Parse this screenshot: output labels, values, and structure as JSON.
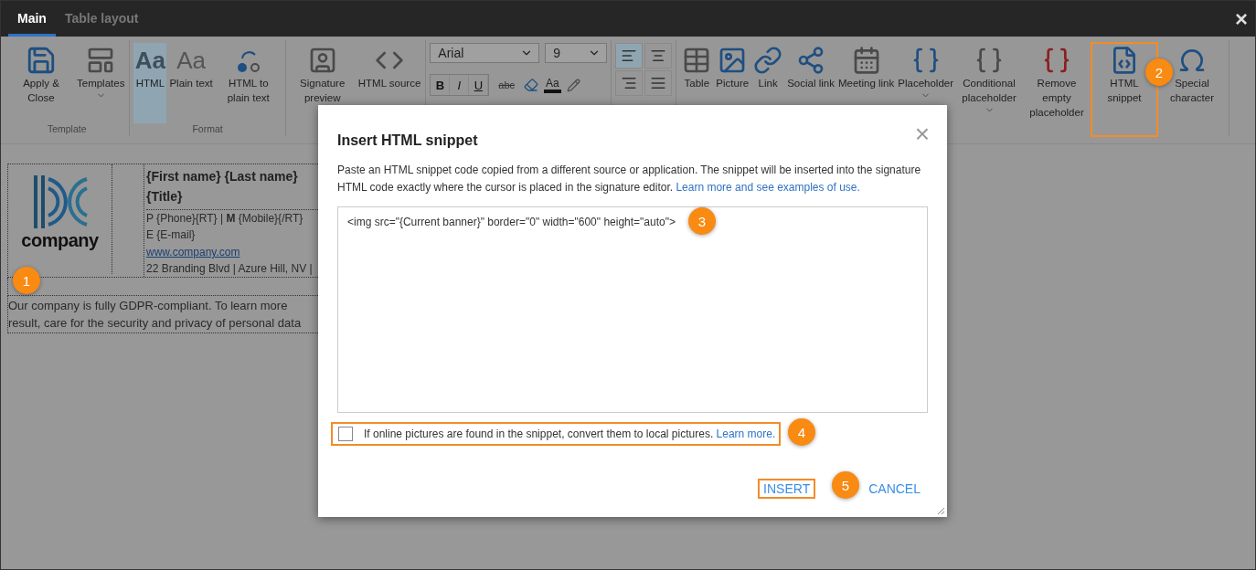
{
  "window": {
    "close_glyph": "×"
  },
  "tabs": [
    {
      "label": "Main",
      "selected": true
    },
    {
      "label": "Table layout",
      "selected": false
    }
  ],
  "ribbon": {
    "groups": [
      {
        "kind": "buttons",
        "label": "Template",
        "items": [
          {
            "label": "Apply & Close",
            "selected": false,
            "caret": false,
            "annotated": false
          },
          {
            "label": "Templates",
            "selected": false,
            "caret": true,
            "annotated": false
          }
        ]
      },
      {
        "kind": "buttons",
        "label": "Format",
        "items": [
          {
            "label": "HTML",
            "glyph": "Aa",
            "selected": true,
            "caret": false,
            "annotated": false
          },
          {
            "label": "Plain text",
            "glyph": "Aa",
            "selected": false,
            "caret": false,
            "annotated": false
          },
          {
            "label": "HTML to plain text",
            "selected": false,
            "caret": false,
            "annotated": false
          }
        ]
      },
      {
        "kind": "buttons",
        "items": [
          {
            "label": "Signature preview",
            "selected": false,
            "caret": false,
            "annotated": false
          },
          {
            "label": "HTML source",
            "selected": false,
            "caret": false,
            "annotated": false
          }
        ]
      },
      {
        "kind": "font",
        "font": "Arial",
        "size": "9",
        "styles": [
          {
            "label": "B"
          },
          {
            "label": "I"
          },
          {
            "label": "U"
          }
        ],
        "strike": "abc",
        "color_label": "Aa"
      },
      {
        "kind": "align",
        "items": [
          {
            "selected": true
          },
          {
            "selected": false
          },
          {
            "selected": false
          },
          {
            "selected": false
          }
        ]
      },
      {
        "kind": "buttons",
        "items": [
          {
            "label": "Table",
            "selected": false,
            "caret": false,
            "annotated": false
          },
          {
            "label": "Picture",
            "selected": false,
            "caret": false,
            "annotated": false
          },
          {
            "label": "Link",
            "selected": false,
            "caret": false,
            "annotated": false
          },
          {
            "label": "Social link",
            "selected": false,
            "caret": false,
            "annotated": false
          },
          {
            "label": "Meeting link",
            "selected": false,
            "caret": false,
            "annotated": false
          },
          {
            "label": "Placeholder",
            "selected": false,
            "caret": true,
            "annotated": false
          },
          {
            "label": "Conditional placeholder",
            "selected": false,
            "caret": true,
            "annotated": false
          },
          {
            "label": "Remove empty placeholder",
            "selected": false,
            "caret": false,
            "annotated": false
          },
          {
            "label": "HTML snippet",
            "selected": false,
            "caret": false,
            "annotated": true
          },
          {
            "label": "Special character",
            "selected": false,
            "caret": false,
            "annotated": false
          }
        ]
      }
    ]
  },
  "signature": {
    "logo_text": "company",
    "name": "{First name} {Last name}",
    "title": "{Title}",
    "lines": [
      {
        "kind": "text",
        "text": "P {Phone}{RT} | **M** {Mobile}{/RT}"
      },
      {
        "kind": "text",
        "text": "E {E-mail}"
      },
      {
        "kind": "link",
        "text": "www.company.com"
      },
      {
        "kind": "text",
        "text": "22 Branding Blvd | Azure Hill, NV |"
      }
    ],
    "footer_lines": [
      "Our company is fully GDPR-compliant. To learn more",
      "result, care for the security and privacy of personal data"
    ]
  },
  "dialog": {
    "title": "Insert HTML snippet",
    "close_glyph": "×",
    "description": "Paste an HTML snippet code copied from a different source or application. The snippet will be inserted into the signature HTML code exactly where the cursor is placed in the signature editor.",
    "description_link": "Learn more and see examples of use.",
    "snippet": "<img src=\"{Current banner}\" border=\"0\" width=\"600\" height=\"auto\">",
    "checkbox": {
      "checked": false,
      "label": "If online pictures are found in the snippet, convert them to local pictures.",
      "link": "Learn more.",
      "annotated": true
    },
    "buttons": [
      {
        "label": "INSERT",
        "annotated": true
      },
      {
        "label": "CANCEL",
        "annotated": false
      }
    ]
  },
  "annotations": [
    "1",
    "2",
    "3",
    "4",
    "5"
  ]
}
